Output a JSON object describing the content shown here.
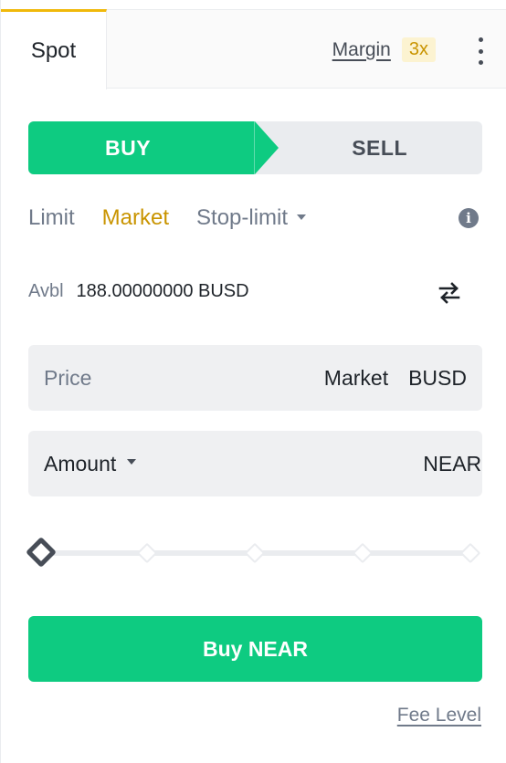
{
  "tabs": {
    "spot": "Spot",
    "margin": "Margin",
    "margin_leverage": "3x"
  },
  "side_toggle": {
    "buy": "BUY",
    "sell": "SELL",
    "active": "buy"
  },
  "order_types": [
    {
      "label": "Limit",
      "active": false
    },
    {
      "label": "Market",
      "active": true
    },
    {
      "label": "Stop-limit",
      "active": false
    }
  ],
  "available": {
    "label": "Avbl",
    "value": "188.00000000 BUSD"
  },
  "price_field": {
    "label": "Price",
    "value": "Market",
    "unit": "BUSD"
  },
  "amount_field": {
    "label": "Amount",
    "value": "",
    "unit": "NEAR"
  },
  "slider": {
    "value_percent": 0,
    "stops": [
      0,
      25,
      50,
      75,
      100
    ]
  },
  "submit": {
    "label": "Buy NEAR"
  },
  "fee_level": {
    "label": "Fee Level"
  },
  "colors": {
    "buy": "#0ecb81",
    "accent": "#f0b90b",
    "active_order_type": "#c99400",
    "text": "#1e2329",
    "muted": "#707a8a"
  },
  "icons": {
    "menu": "kebab-icon",
    "info": "info-icon",
    "transfer": "swap-arrows-icon",
    "dropdown": "caret-down-icon"
  }
}
